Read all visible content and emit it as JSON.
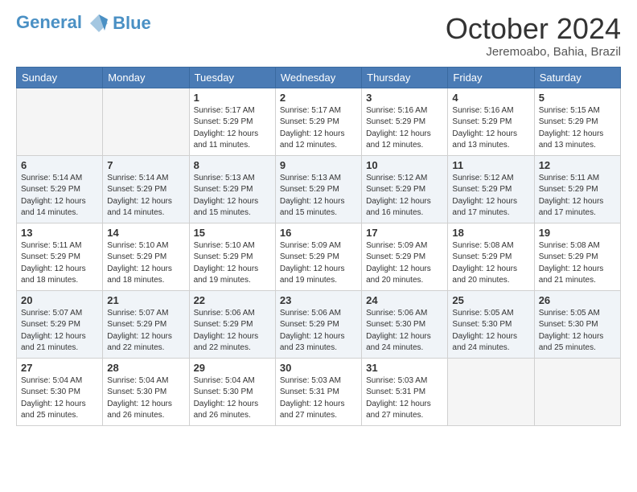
{
  "logo": {
    "line1": "General",
    "line2": "Blue"
  },
  "title": "October 2024",
  "location": "Jeremoabo, Bahia, Brazil",
  "weekdays": [
    "Sunday",
    "Monday",
    "Tuesday",
    "Wednesday",
    "Thursday",
    "Friday",
    "Saturday"
  ],
  "weeks": [
    [
      {
        "day": "",
        "info": ""
      },
      {
        "day": "",
        "info": ""
      },
      {
        "day": "1",
        "info": "Sunrise: 5:17 AM\nSunset: 5:29 PM\nDaylight: 12 hours\nand 11 minutes."
      },
      {
        "day": "2",
        "info": "Sunrise: 5:17 AM\nSunset: 5:29 PM\nDaylight: 12 hours\nand 12 minutes."
      },
      {
        "day": "3",
        "info": "Sunrise: 5:16 AM\nSunset: 5:29 PM\nDaylight: 12 hours\nand 12 minutes."
      },
      {
        "day": "4",
        "info": "Sunrise: 5:16 AM\nSunset: 5:29 PM\nDaylight: 12 hours\nand 13 minutes."
      },
      {
        "day": "5",
        "info": "Sunrise: 5:15 AM\nSunset: 5:29 PM\nDaylight: 12 hours\nand 13 minutes."
      }
    ],
    [
      {
        "day": "6",
        "info": "Sunrise: 5:14 AM\nSunset: 5:29 PM\nDaylight: 12 hours\nand 14 minutes."
      },
      {
        "day": "7",
        "info": "Sunrise: 5:14 AM\nSunset: 5:29 PM\nDaylight: 12 hours\nand 14 minutes."
      },
      {
        "day": "8",
        "info": "Sunrise: 5:13 AM\nSunset: 5:29 PM\nDaylight: 12 hours\nand 15 minutes."
      },
      {
        "day": "9",
        "info": "Sunrise: 5:13 AM\nSunset: 5:29 PM\nDaylight: 12 hours\nand 15 minutes."
      },
      {
        "day": "10",
        "info": "Sunrise: 5:12 AM\nSunset: 5:29 PM\nDaylight: 12 hours\nand 16 minutes."
      },
      {
        "day": "11",
        "info": "Sunrise: 5:12 AM\nSunset: 5:29 PM\nDaylight: 12 hours\nand 17 minutes."
      },
      {
        "day": "12",
        "info": "Sunrise: 5:11 AM\nSunset: 5:29 PM\nDaylight: 12 hours\nand 17 minutes."
      }
    ],
    [
      {
        "day": "13",
        "info": "Sunrise: 5:11 AM\nSunset: 5:29 PM\nDaylight: 12 hours\nand 18 minutes."
      },
      {
        "day": "14",
        "info": "Sunrise: 5:10 AM\nSunset: 5:29 PM\nDaylight: 12 hours\nand 18 minutes."
      },
      {
        "day": "15",
        "info": "Sunrise: 5:10 AM\nSunset: 5:29 PM\nDaylight: 12 hours\nand 19 minutes."
      },
      {
        "day": "16",
        "info": "Sunrise: 5:09 AM\nSunset: 5:29 PM\nDaylight: 12 hours\nand 19 minutes."
      },
      {
        "day": "17",
        "info": "Sunrise: 5:09 AM\nSunset: 5:29 PM\nDaylight: 12 hours\nand 20 minutes."
      },
      {
        "day": "18",
        "info": "Sunrise: 5:08 AM\nSunset: 5:29 PM\nDaylight: 12 hours\nand 20 minutes."
      },
      {
        "day": "19",
        "info": "Sunrise: 5:08 AM\nSunset: 5:29 PM\nDaylight: 12 hours\nand 21 minutes."
      }
    ],
    [
      {
        "day": "20",
        "info": "Sunrise: 5:07 AM\nSunset: 5:29 PM\nDaylight: 12 hours\nand 21 minutes."
      },
      {
        "day": "21",
        "info": "Sunrise: 5:07 AM\nSunset: 5:29 PM\nDaylight: 12 hours\nand 22 minutes."
      },
      {
        "day": "22",
        "info": "Sunrise: 5:06 AM\nSunset: 5:29 PM\nDaylight: 12 hours\nand 22 minutes."
      },
      {
        "day": "23",
        "info": "Sunrise: 5:06 AM\nSunset: 5:29 PM\nDaylight: 12 hours\nand 23 minutes."
      },
      {
        "day": "24",
        "info": "Sunrise: 5:06 AM\nSunset: 5:30 PM\nDaylight: 12 hours\nand 24 minutes."
      },
      {
        "day": "25",
        "info": "Sunrise: 5:05 AM\nSunset: 5:30 PM\nDaylight: 12 hours\nand 24 minutes."
      },
      {
        "day": "26",
        "info": "Sunrise: 5:05 AM\nSunset: 5:30 PM\nDaylight: 12 hours\nand 25 minutes."
      }
    ],
    [
      {
        "day": "27",
        "info": "Sunrise: 5:04 AM\nSunset: 5:30 PM\nDaylight: 12 hours\nand 25 minutes."
      },
      {
        "day": "28",
        "info": "Sunrise: 5:04 AM\nSunset: 5:30 PM\nDaylight: 12 hours\nand 26 minutes."
      },
      {
        "day": "29",
        "info": "Sunrise: 5:04 AM\nSunset: 5:30 PM\nDaylight: 12 hours\nand 26 minutes."
      },
      {
        "day": "30",
        "info": "Sunrise: 5:03 AM\nSunset: 5:31 PM\nDaylight: 12 hours\nand 27 minutes."
      },
      {
        "day": "31",
        "info": "Sunrise: 5:03 AM\nSunset: 5:31 PM\nDaylight: 12 hours\nand 27 minutes."
      },
      {
        "day": "",
        "info": ""
      },
      {
        "day": "",
        "info": ""
      }
    ]
  ]
}
